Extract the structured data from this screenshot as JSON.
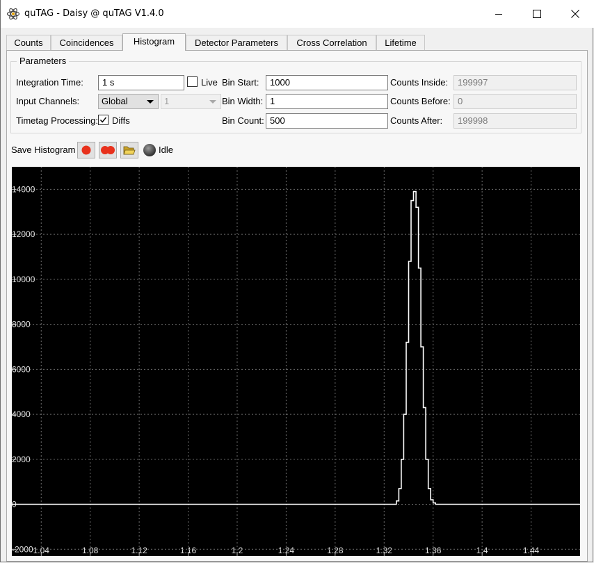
{
  "window": {
    "title": "quTAG - Daisy @ quTAG V1.4.0"
  },
  "tabs": [
    {
      "label": "Counts"
    },
    {
      "label": "Coincidences"
    },
    {
      "label": "Histogram",
      "active": true
    },
    {
      "label": "Detector Parameters"
    },
    {
      "label": "Cross Correlation"
    },
    {
      "label": "Lifetime"
    }
  ],
  "parameters": {
    "group_title": "Parameters",
    "integration_time_label": "Integration Time:",
    "integration_time_value": "1 s",
    "live_label": "Live",
    "live_checked": false,
    "input_channels_label": "Input Channels:",
    "input_channels_value": "Global",
    "channel_value": "1",
    "timetag_processing_label": "Timetag Processing:",
    "diffs_label": "Diffs",
    "diffs_checked": true,
    "bin_start_label": "Bin Start:",
    "bin_start_value": "1000",
    "bin_width_label": "Bin Width:",
    "bin_width_value": "1",
    "bin_count_label": "Bin Count:",
    "bin_count_value": "500",
    "counts_inside_label": "Counts Inside:",
    "counts_inside_value": "199997",
    "counts_before_label": "Counts Before:",
    "counts_before_value": "0",
    "counts_after_label": "Counts After:",
    "counts_after_value": "199998"
  },
  "toolbar": {
    "save_label": "Save Histogram",
    "record_icon": "record-icon",
    "record_multi_icon": "record-multiple-icon",
    "open_folder_icon": "folder-open-icon",
    "status_icon": "status-led-icon",
    "status": "Idle"
  },
  "colors": {
    "plot_background": "#000000",
    "trace": "#ffffff",
    "grid": "#6e6e6e",
    "record": "#e8311c"
  },
  "chart_data": {
    "type": "line",
    "xlim": [
      1.016,
      1.48
    ],
    "ylim": [
      -2300,
      15000
    ],
    "x_ticks": [
      1.04,
      1.08,
      1.12,
      1.16,
      1.2,
      1.24,
      1.28,
      1.32,
      1.36,
      1.4,
      1.44
    ],
    "x_tick_labels": [
      "1.04",
      "1.08",
      "1.12",
      "1.16",
      "1.2",
      "1.24",
      "1.28",
      "1.32",
      "1.36",
      "1.4",
      "1.44"
    ],
    "y_ticks": [
      -2000,
      0,
      2000,
      4000,
      6000,
      8000,
      10000,
      12000,
      14000
    ],
    "y_tick_labels": [
      "-2000",
      "0",
      "2000",
      "4000",
      "6000",
      "8000",
      "10000",
      "12000",
      "14000"
    ],
    "grid": true,
    "series": [
      {
        "x": [
          1.016,
          1.328,
          1.33,
          1.332,
          1.334,
          1.336,
          1.338,
          1.34,
          1.342,
          1.344,
          1.346,
          1.348,
          1.35,
          1.352,
          1.354,
          1.356,
          1.358,
          1.36,
          1.362,
          1.48
        ],
        "y": [
          0,
          0,
          150,
          700,
          2000,
          4000,
          7200,
          10800,
          13500,
          13900,
          13200,
          10500,
          7000,
          4300,
          2000,
          700,
          200,
          60,
          0,
          0
        ]
      }
    ]
  }
}
